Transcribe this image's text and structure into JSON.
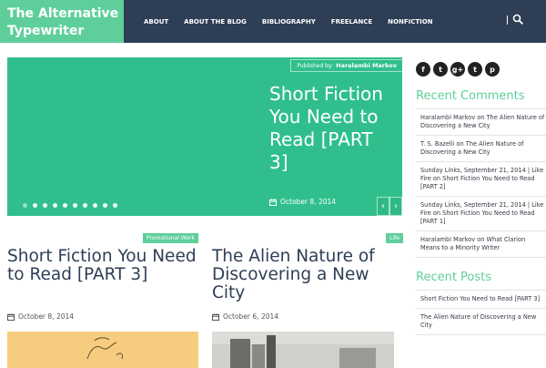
{
  "site": {
    "title_line1": "The Alternative",
    "title_line2": "Typewriter"
  },
  "nav": {
    "items": [
      "ABOUT",
      "ABOUT THE BLOG",
      "BIBLIOGRAPHY",
      "FREELANCE",
      "NONFICTION"
    ]
  },
  "colors": {
    "accent": "#5ecf9a",
    "header_bg": "#2e3e55",
    "slider_bg": "#30bf8c",
    "title_text": "#2e3e55"
  },
  "icons": {
    "search": "search-icon",
    "calendar": "calendar-icon",
    "facebook": "facebook-icon",
    "twitter": "twitter-icon",
    "googleplus": "google-plus-icon",
    "tumblr": "tumblr-icon",
    "pinterest": "pinterest-icon"
  },
  "slider": {
    "published_label": "Published by:",
    "author": "Haralambi Markov",
    "title": "Short Fiction You Need to Read [PART 3]",
    "date": "October 8, 2014",
    "prev_symbol": "‹",
    "next_symbol": "›"
  },
  "posts": [
    {
      "tag": "Promotional Work",
      "title": "Short Fiction You Need to Read [PART 3]",
      "date": "October 8, 2014"
    },
    {
      "tag": "Life",
      "title": "The Alien Nature of Discovering a New City",
      "date": "October 6, 2014"
    }
  ],
  "sidebar": {
    "social": {
      "facebook": "f",
      "twitter": "t",
      "googleplus": "g+",
      "tumblr": "t",
      "pinterest": "p"
    },
    "recent_comments_title": "Recent Comments",
    "recent_comments": [
      "Haralambi Markov on The Alien Nature of Discovering a New City",
      "T. S. Bazelli on The Alien Nature of Discovering a New City",
      "Sunday Links, September 21, 2014 | Like Fire on Short Fiction You Need to Read [PART 2]",
      "Sunday Links, September 21, 2014 | Like Fire on Short Fiction You Need to Read [PART 1]",
      "Haralambi Markov on What Clarion Means to a Minority Writer"
    ],
    "recent_posts_title": "Recent Posts",
    "recent_posts": [
      "Short Fiction You Need to Read [PART 3]",
      "The Alien Nature of Discovering a New City"
    ]
  }
}
